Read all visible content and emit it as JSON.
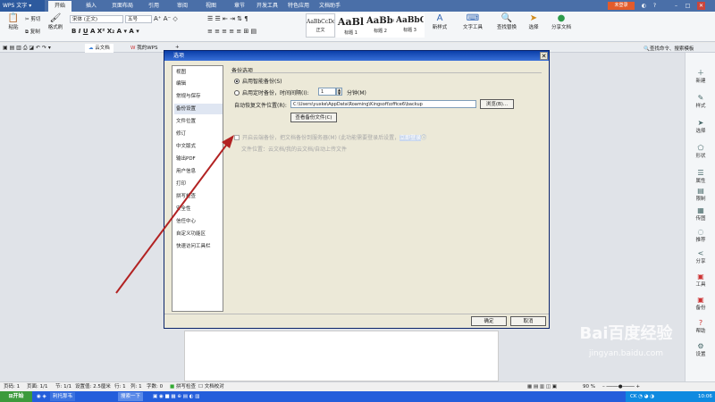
{
  "app": {
    "name": "WPS 文字",
    "login_label": "未登录"
  },
  "ribbon_tabs": [
    "开始",
    "插入",
    "页面布局",
    "引用",
    "审阅",
    "视图",
    "章节",
    "开发工具",
    "特色应用",
    "文档助手"
  ],
  "ribbon": {
    "paste": "粘贴",
    "cut": "剪切",
    "copy": "复制",
    "format_painter": "格式刷",
    "font_name": "宋体 (正文)",
    "font_size": "五号",
    "styles": [
      {
        "preview": "AaBbCcDd",
        "label": "正文"
      },
      {
        "preview": "AaBl",
        "label": "标题 1"
      },
      {
        "preview": "AaBb(",
        "label": "标题 2"
      },
      {
        "preview": "AaBbC",
        "label": "标题 3"
      }
    ],
    "new_style": "新样式",
    "text_tools": "文字工具",
    "find_replace": "查找替换",
    "select": "选择",
    "share_doc": "分享文档"
  },
  "doc_tabs": {
    "cloud": "云文档",
    "my_wps": "我的WPS"
  },
  "search_hint": "查找命令、搜索模板",
  "right_sidebar": [
    "新建",
    "样式",
    "选择",
    "形状",
    "属性",
    "限制",
    "传图",
    "推荐",
    "分享",
    "工具",
    "备份",
    "帮助",
    "设置"
  ],
  "dialog": {
    "title": "选项",
    "nav": [
      "视图",
      "编辑",
      "常规与保存",
      "备份设置",
      "文件位置",
      "修订",
      "中文版式",
      "输出PDF",
      "用户信息",
      "打印",
      "拼写检查",
      "安全性",
      "信任中心",
      "自定义功能区",
      "快速访问工具栏"
    ],
    "selected_nav": "备份设置",
    "group_title": "备份选项",
    "opt_smart": "启用智能备份(S)",
    "opt_timed": "启用定时备份，时间间隔(I):",
    "interval_value": "1",
    "interval_unit": "分钟(M)",
    "path_label": "自动恢复文件位置(R):",
    "path_value": "C:\\Users\\yuxke\\AppData\\Roaming\\Kingsoft\\office6\\backup",
    "browse": "浏览(B)...",
    "view_backup": "查看备份文件(C)",
    "cloud_backup": "开启云端备份，把文档备份到服务器(M) (此功能需要登录后设置，",
    "cloud_login": "立即登录",
    "file_location": "文件位置：云文档/我的云文档/自动上传文件",
    "ok": "确定",
    "cancel": "取消"
  },
  "statusbar": {
    "page": "页码: 1",
    "pages": "页面: 1/1",
    "section": "节: 1/1",
    "setting": "设置值: 2.5厘米",
    "row": "行: 1",
    "col": "列: 1",
    "words": "字数: 0",
    "spell": "拼写检查",
    "proof": "文档校对",
    "zoom": "90 %"
  },
  "taskbar": {
    "start": "开始",
    "items": [
      "利托那韦",
      "搜索一下"
    ],
    "clock": "10:06"
  },
  "watermark": {
    "brand": "Bai百度经验",
    "url": "jingyan.baidu.com"
  },
  "colors": {
    "title_blue": "#4a6fa8",
    "dialog_title": "#0a3ea8",
    "arrow": "#b22222"
  }
}
